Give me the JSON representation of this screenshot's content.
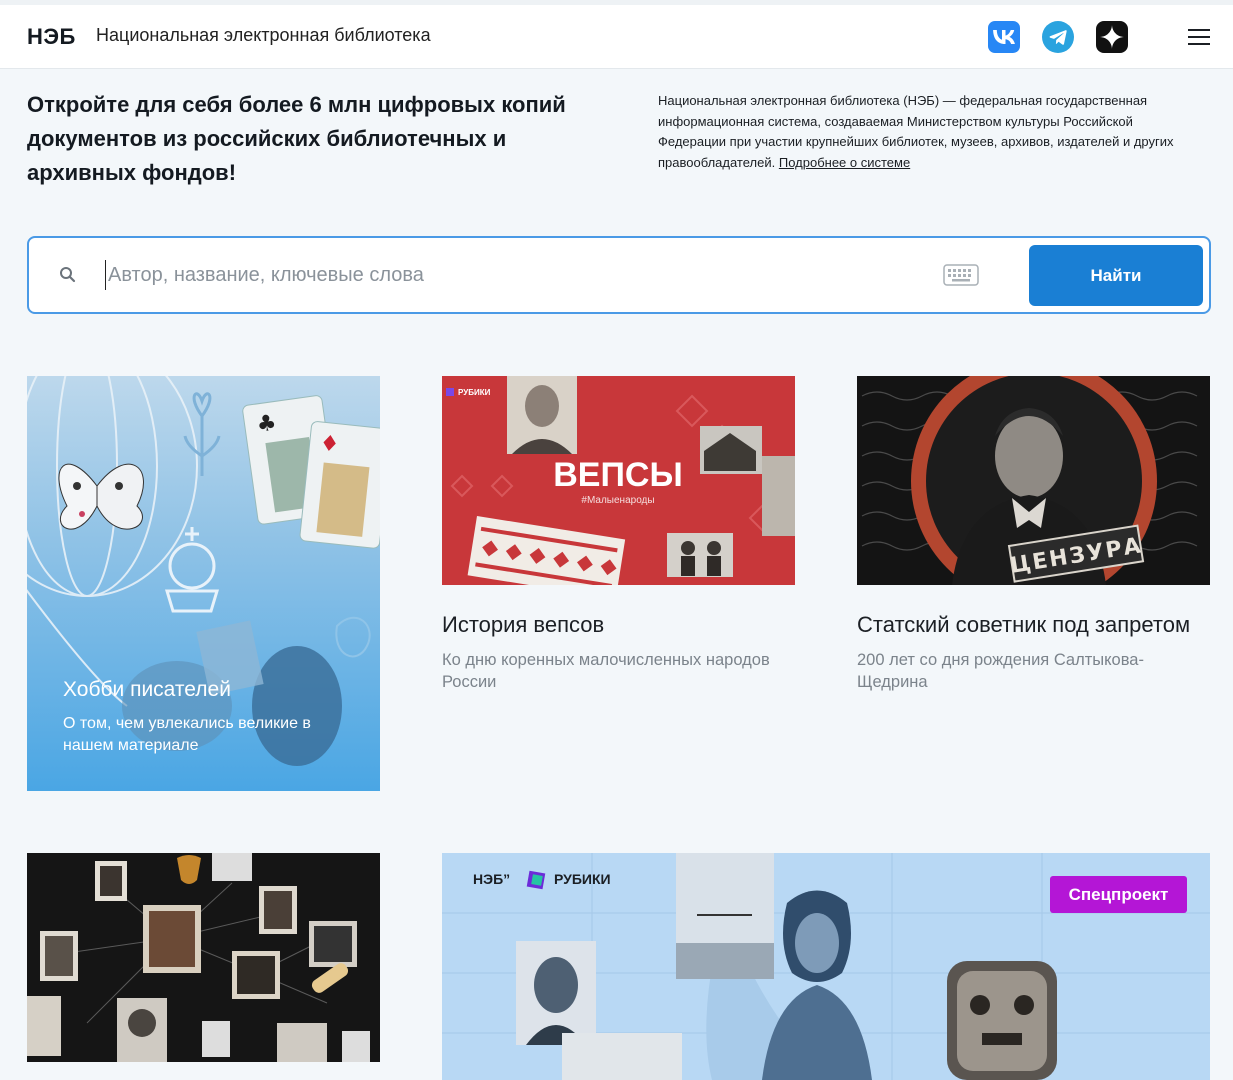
{
  "header": {
    "logo": "НЭБ",
    "site_name": "Национальная электронная библиотека",
    "social": [
      "vk-icon",
      "telegram-icon",
      "dzen-icon"
    ]
  },
  "hero": {
    "title": "Откройте для себя более 6 млн цифровых копий документов из российских библиотечных и архивных фондов!",
    "description": "Национальная электронная библиотека (НЭБ) — федеральная государственная информационная система, создаваемая Министерством культуры Российской Федерации при участии крупнейших библиотек, музеев, архивов, издателей и других правообладателей.",
    "more_link": "Подробнее о системе"
  },
  "search": {
    "placeholder": "Автор, название, ключевые слова",
    "button": "Найти"
  },
  "cards": [
    {
      "title": "Хобби писателей",
      "desc": "О том, чем увлекались великие в нашем материале"
    },
    {
      "title": "История вепсов",
      "desc": "Ко дню коренных малочисленных народов России",
      "image_text": "ВЕПСЫ",
      "image_tag": "#Малыенароды",
      "image_brand": "РУБИКИ"
    },
    {
      "title": "Статский советник под запретом",
      "desc": "200 лет со дня рождения Салтыкова-Щедрина",
      "image_stamp": "ЦЕНЗУРА"
    },
    {
      "title": ""
    },
    {
      "badge": "Спецпроект",
      "brand_left": "НЭБ”",
      "brand_right": "РУБИКИ"
    }
  ],
  "colors": {
    "accent": "#1a7fd4",
    "badge": "#b416d6",
    "page_bg": "#f3f7fa"
  }
}
